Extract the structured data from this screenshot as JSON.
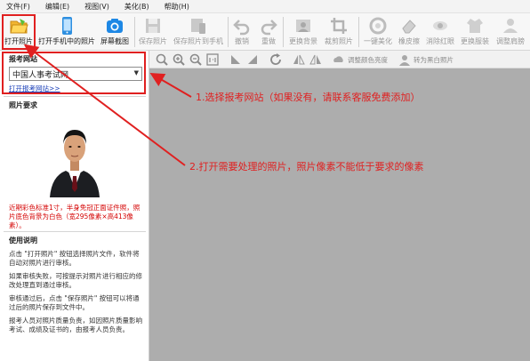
{
  "menubar": {
    "items": [
      "文件(F)",
      "编辑(E)",
      "视图(V)",
      "美化(B)",
      "帮助(H)"
    ]
  },
  "toolbar": {
    "buttons": [
      {
        "label": "打开照片",
        "icon": "folder-open-icon",
        "enabled": true
      },
      {
        "label": "打开手机中的照片",
        "icon": "phone-icon",
        "enabled": true
      },
      {
        "label": "屏幕截图",
        "icon": "camera-icon",
        "enabled": true
      },
      {
        "label": "保存照片",
        "icon": "save-icon",
        "enabled": false
      },
      {
        "label": "保存照片到手机",
        "icon": "save-to-phone-icon",
        "enabled": false
      },
      {
        "label": "撤销",
        "icon": "undo-icon",
        "enabled": false
      },
      {
        "label": "重做",
        "icon": "redo-icon",
        "enabled": false
      },
      {
        "label": "更换背景",
        "icon": "change-background-icon",
        "enabled": false
      },
      {
        "label": "裁剪照片",
        "icon": "crop-icon",
        "enabled": false
      },
      {
        "label": "一键美化",
        "icon": "beautify-icon",
        "enabled": false
      },
      {
        "label": "橡皮擦",
        "icon": "eraser-icon",
        "enabled": false
      },
      {
        "label": "消除红眼",
        "icon": "red-eye-icon",
        "enabled": false
      },
      {
        "label": "更换服装",
        "icon": "clothes-icon",
        "enabled": false
      },
      {
        "label": "调整肩膀",
        "icon": "shoulder-icon",
        "enabled": false
      }
    ]
  },
  "sidebar": {
    "exam_site_title": "报考网站",
    "exam_site_value": "中国人事考试网",
    "open_site_link": "打开报考网站>>",
    "photo_requirement_title": "照片要求",
    "photo_requirement_note": "近期彩色标准1寸，半身免冠正面证件照，照片底色背景为白色（宽295像素×高413像素）。",
    "help_title": "使用说明",
    "help_paragraphs": [
      "点击 \"打开照片\" 按钮选择照片文件，软件将自动对照片进行审核。",
      "如果审核失败，可按提示对照片进行相应的修改处理直到通过审核。",
      "审核通过后，点击 \"保存照片\" 按钮可以将通过后的照片保存到文件中。",
      "报考人员对照片质量负责，如因照片质量影响考试、成绩及证书的，由报考人员负责。"
    ]
  },
  "viewbar": {
    "adjust_color_label": "调整颜色亮度",
    "to_bw_label": "转为黑白照片"
  },
  "annotations": {
    "step1": "1.选择报考网站（如果没有，请联系客服免费添加）",
    "step2": "2.打开需要处理的照片，照片像素不能低于要求的像素"
  },
  "colors": {
    "highlight": "#e02020",
    "link": "#1a3fb8",
    "canvas": "#adadad",
    "note_red": "#d40000"
  }
}
